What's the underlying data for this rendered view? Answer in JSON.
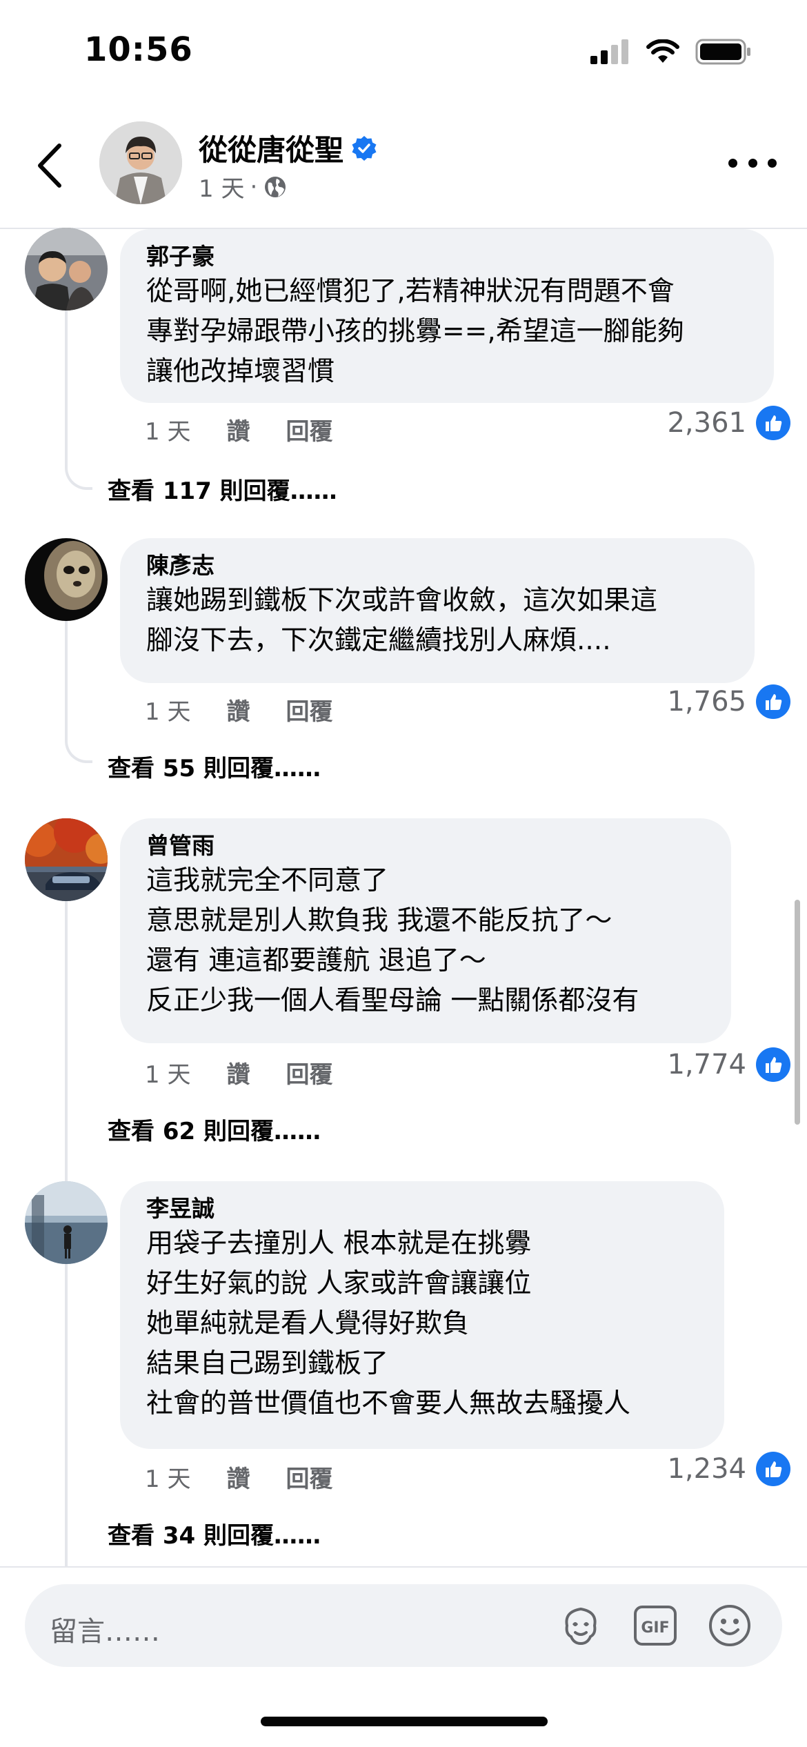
{
  "status_bar": {
    "time": "10:56"
  },
  "header": {
    "page_name": "從從唐從聖",
    "time_ago": "1 天",
    "separator": "·"
  },
  "comments": [
    {
      "author": "郭子豪",
      "lines": [
        "從哥啊,她已經慣犯了,若精神狀況有問題不會",
        "專對孕婦跟帶小孩的挑釁==,希望這一腳能夠",
        "讓他改掉壞習慣"
      ],
      "time": "1 天",
      "like_label": "讚",
      "reply_label": "回覆",
      "likes": "2,361",
      "view_replies": "查看 117 則回覆……"
    },
    {
      "author": "陳彥志",
      "lines": [
        "讓她踢到鐵板下次或許會收斂，這次如果這",
        "腳沒下去，下次鐵定繼續找別人麻煩...."
      ],
      "time": "1 天",
      "like_label": "讚",
      "reply_label": "回覆",
      "likes": "1,765",
      "view_replies": "查看 55 則回覆……"
    },
    {
      "author": "曾管雨",
      "lines": [
        "這我就完全不同意了",
        "意思就是別人欺負我  我還不能反抗了～",
        "還有  連這都要護航 退追了～",
        "反正少我一個人看聖母論 一點關係都沒有"
      ],
      "time": "1 天",
      "like_label": "讚",
      "reply_label": "回覆",
      "likes": "1,774",
      "view_replies": "查看 62 則回覆……"
    },
    {
      "author": "李昱誠",
      "lines": [
        "用袋子去撞別人 根本就是在挑釁",
        "好生好氣的說 人家或許會讓讓位",
        "她單純就是看人覺得好欺負",
        "結果自己踢到鐵板了",
        "社會的普世價值也不會要人無故去騷擾人"
      ],
      "time": "1 天",
      "like_label": "讚",
      "reply_label": "回覆",
      "likes": "1,234",
      "view_replies": "查看 34 則回覆……"
    }
  ],
  "composer": {
    "placeholder": "留言……",
    "gif_label": "GIF"
  },
  "colors": {
    "accent": "#1877f2",
    "bubble": "#f0f2f5",
    "secondary_text": "#65676b"
  }
}
